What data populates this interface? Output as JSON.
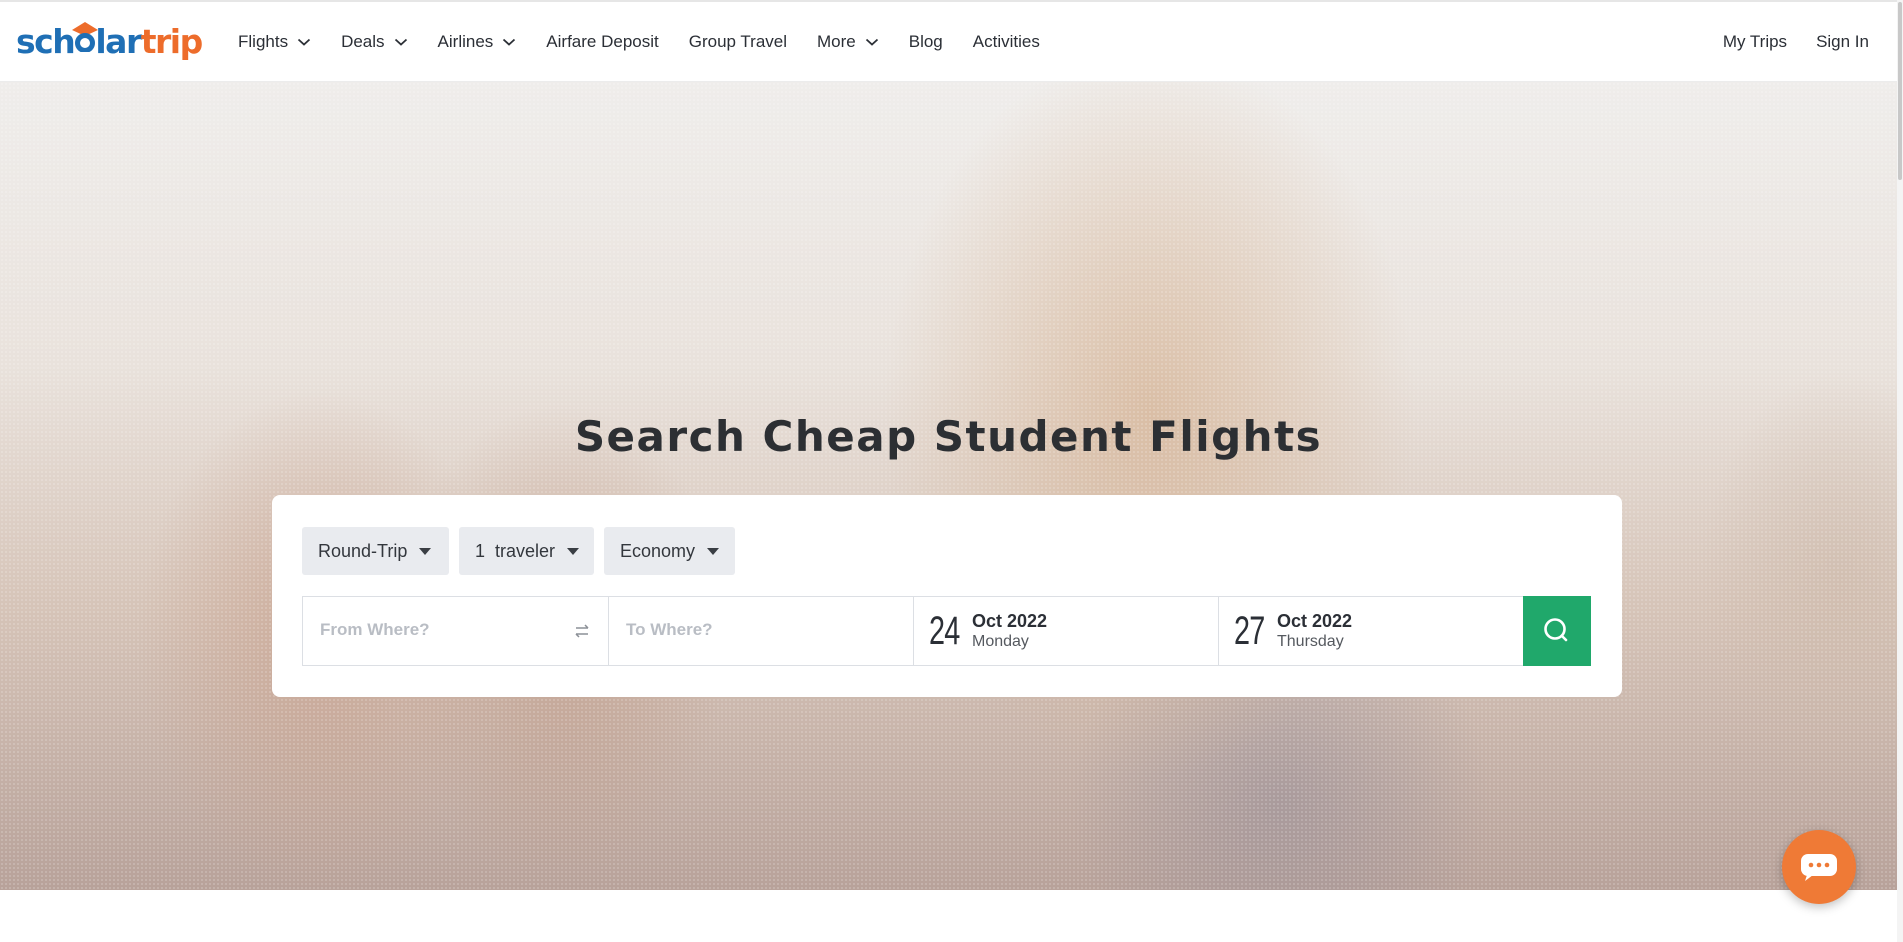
{
  "logo": {
    "part1": "sch",
    "hat_letter": "o",
    "part1b": "lar",
    "part2": "trip"
  },
  "nav": {
    "items": [
      {
        "label": "Flights",
        "dropdown": true
      },
      {
        "label": "Deals",
        "dropdown": true
      },
      {
        "label": "Airlines",
        "dropdown": true
      },
      {
        "label": "Airfare Deposit",
        "dropdown": false
      },
      {
        "label": "Group Travel",
        "dropdown": false
      },
      {
        "label": "More",
        "dropdown": true
      },
      {
        "label": "Blog",
        "dropdown": false
      },
      {
        "label": "Activities",
        "dropdown": false
      }
    ],
    "right": [
      {
        "label": "My Trips"
      },
      {
        "label": "Sign In"
      }
    ]
  },
  "hero": {
    "title": "Search Cheap Student Flights"
  },
  "search": {
    "trip_type": "Round-Trip",
    "travelers": "1  traveler",
    "cabin": "Economy",
    "from_placeholder": "From Where?",
    "to_placeholder": "To Where?",
    "depart": {
      "day": "24",
      "month_year": "Oct 2022",
      "weekday": "Monday"
    },
    "return": {
      "day": "27",
      "month_year": "Oct 2022",
      "weekday": "Thursday"
    }
  },
  "colors": {
    "brand_blue": "#1f6fb5",
    "brand_orange": "#ed6c2b",
    "search_green": "#20a86b",
    "chat_orange": "#ef7a36"
  },
  "icons": [
    "chevron-down-icon",
    "swap-icon",
    "search-icon",
    "chat-icon",
    "graduation-cap-icon"
  ]
}
